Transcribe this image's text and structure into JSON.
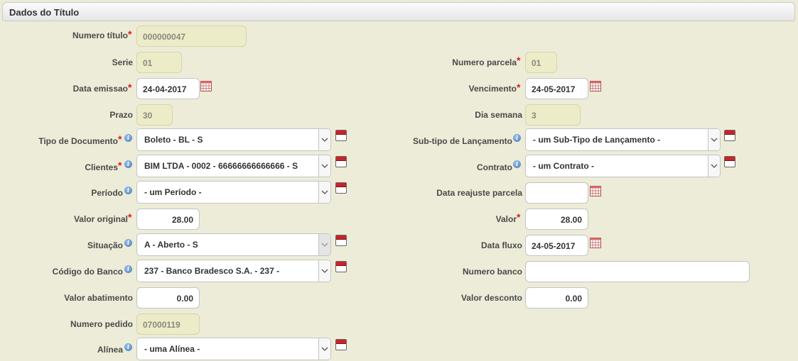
{
  "panel": {
    "title": "Dados do Título"
  },
  "icons": {
    "info": "info-icon",
    "calendar": "calendar-icon",
    "lookup": "lookup-book-icon",
    "required": "required-asterisk",
    "dropdown": "chevron-down-icon"
  },
  "colors": {
    "required": "#d81e1e",
    "background": "#ececd8",
    "readonly_field": "#ececc8"
  },
  "required_mark": "*",
  "info_glyph": "i",
  "left": {
    "numero_titulo": {
      "label": "Numero título",
      "value": "000000047"
    },
    "serie": {
      "label": "Serie",
      "value": "01"
    },
    "data_emissao": {
      "label": "Data emissao",
      "value": "24-04-2017"
    },
    "prazo": {
      "label": "Prazo",
      "value": "30"
    },
    "tipo_documento": {
      "label": "Tipo de Documento",
      "value": "Boleto - BL - S"
    },
    "clientes": {
      "label": "Clientes",
      "value": "BIM LTDA - 0002 - 66666666666666 - S"
    },
    "periodo": {
      "label": "Período",
      "value": "- um Período -"
    },
    "valor_original": {
      "label": "Valor original",
      "value": "28.00"
    },
    "situacao": {
      "label": "Situação",
      "value": "A - Aberto - S"
    },
    "codigo_banco": {
      "label": "Código do Banco",
      "value": "237 - Banco Bradesco S.A. - 237 -"
    },
    "valor_abatimento": {
      "label": "Valor abatimento",
      "value": "0.00"
    },
    "numero_pedido": {
      "label": "Numero pedido",
      "value": "07000119"
    },
    "alinea": {
      "label": "Alínea",
      "value": "- uma Alínea -"
    }
  },
  "right": {
    "numero_parcela": {
      "label": "Numero parcela",
      "value": "01"
    },
    "vencimento": {
      "label": "Vencimento",
      "value": "24-05-2017"
    },
    "dia_semana": {
      "label": "Dia semana",
      "value": "3"
    },
    "subtipo_lancamento": {
      "label": "Sub-tipo de Lançamento",
      "value": "- um Sub-Tipo de Lançamento -"
    },
    "contrato": {
      "label": "Contrato",
      "value": "- um Contrato -"
    },
    "data_reajuste": {
      "label": "Data reajuste parcela",
      "value": ""
    },
    "valor": {
      "label": "Valor",
      "value": "28.00"
    },
    "data_fluxo": {
      "label": "Data fluxo",
      "value": "24-05-2017"
    },
    "numero_banco": {
      "label": "Numero banco",
      "value": ""
    },
    "valor_desconto": {
      "label": "Valor desconto",
      "value": "0.00"
    }
  }
}
